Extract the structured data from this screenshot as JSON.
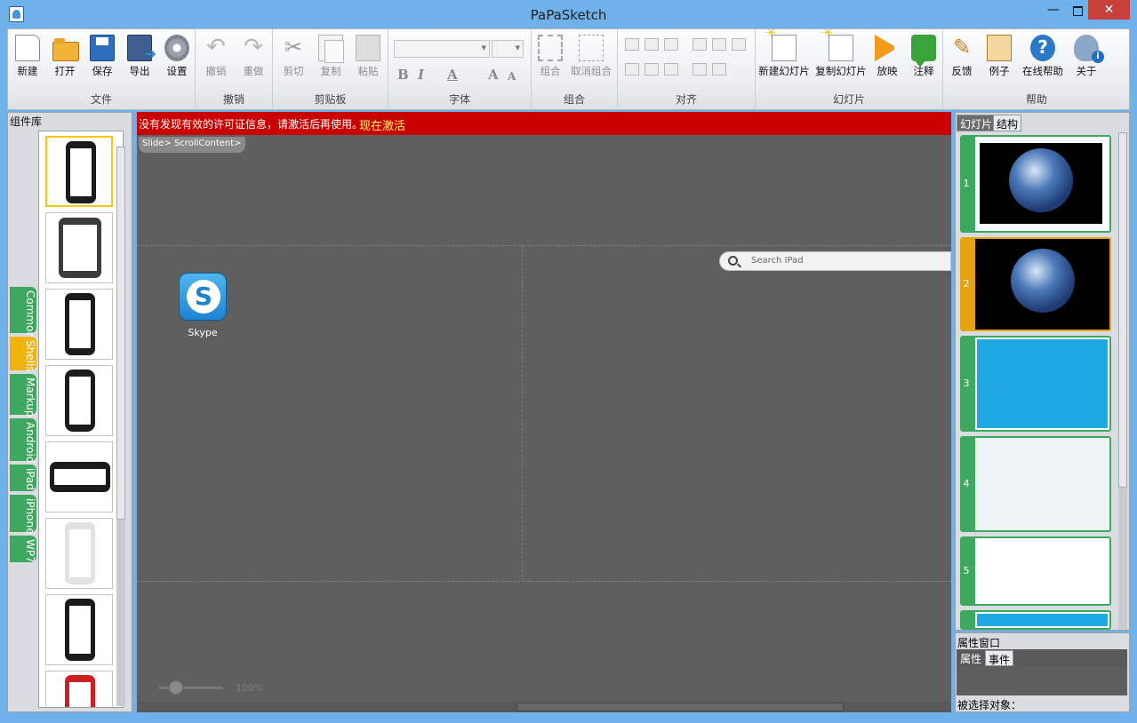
{
  "window": {
    "title": "PaPaSketch",
    "min_label": "—",
    "close_label": "✕"
  },
  "ribbon": {
    "file": {
      "label": "文件",
      "new": "新建",
      "open": "打开",
      "save": "保存",
      "export": "导出",
      "settings": "设置"
    },
    "undo": {
      "label": "撤销",
      "undo": "撤销",
      "redo": "重做"
    },
    "clipboard": {
      "label": "剪贴板",
      "cut": "剪切",
      "copy": "复制",
      "paste": "粘贴"
    },
    "font": {
      "label": "字体",
      "bold": "B",
      "italic": "I",
      "color": "A",
      "grow": "A",
      "shrink": "A"
    },
    "group": {
      "label": "组合",
      "group": "组合",
      "ungroup": "取消组合"
    },
    "align": {
      "label": "对齐"
    },
    "slides": {
      "label": "幻灯片",
      "new_slide": "新建幻灯片",
      "copy_slide": "复制幻灯片",
      "play": "放映",
      "note": "注释"
    },
    "help": {
      "label": "帮助",
      "feedback": "反馈",
      "examples": "例子",
      "online_help": "在线帮助",
      "about": "关于"
    }
  },
  "library": {
    "title": "组件库",
    "tabs": [
      "Common",
      "Shells",
      "Markup",
      "Android",
      "iPad",
      "iPhone",
      "WP7"
    ],
    "active_tab": "Shells"
  },
  "canvas": {
    "license_msg": "没有发现有效的许可证信息，请激活后再使用。",
    "license_link": "现在激活",
    "breadcrumb": "Slide> ScrollContent>",
    "skype_label": "Skype",
    "skype_glyph": "S",
    "search_placeholder": "Search IPad",
    "zoom": "100%"
  },
  "slides_panel": {
    "tab_slides": "幻灯片",
    "tab_structure": "结构",
    "slides": [
      "1",
      "2",
      "3",
      "4",
      "5"
    ],
    "selected": "2"
  },
  "properties": {
    "title": "属性窗口",
    "tab_props": "属性",
    "tab_events": "事件",
    "selected_label": "被选择对象："
  },
  "colors": {
    "accent_green": "#3ea861",
    "accent_yellow": "#f1b40f",
    "license_red": "#c80000",
    "link_yellow": "#ffff6a"
  }
}
